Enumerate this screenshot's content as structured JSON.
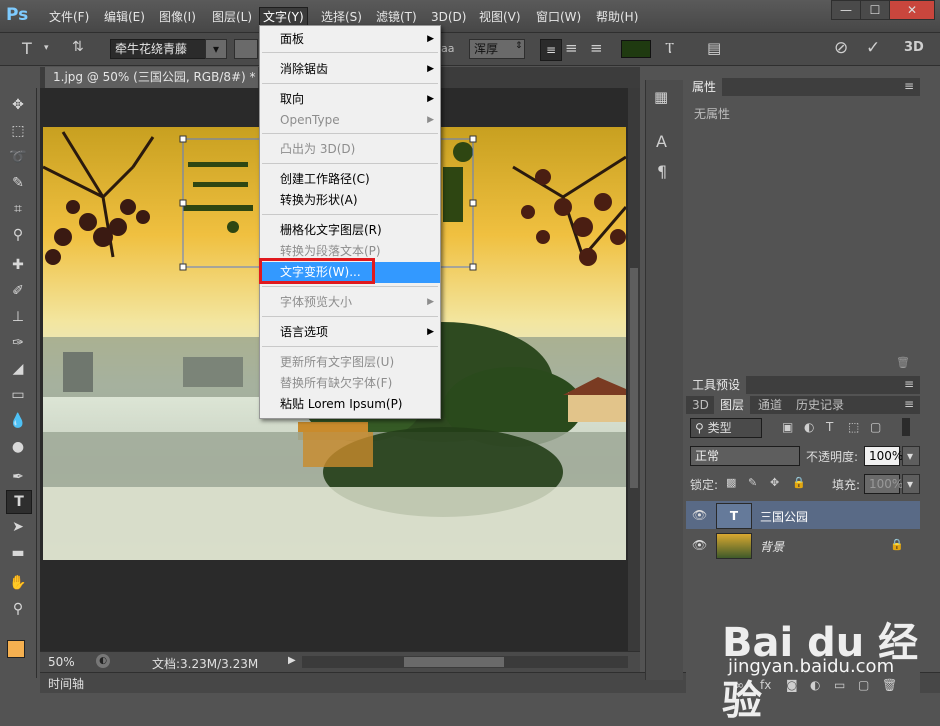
{
  "app": {
    "logo": "Ps"
  },
  "menubar": {
    "items": [
      "文件(F)",
      "编辑(E)",
      "图像(I)",
      "图层(L)",
      "文字(Y)",
      "选择(S)",
      "滤镜(T)",
      "3D(D)",
      "视图(V)",
      "窗口(W)",
      "帮助(H)"
    ],
    "active": "文字(Y)"
  },
  "window_controls": {
    "minimize": "—",
    "maximize": "☐",
    "close": "✕"
  },
  "options_bar": {
    "font_family": "牵牛花绕青藤",
    "font_size_unit": "aa",
    "antialias": "浑厚",
    "color": "#1f3a10",
    "label_3d": "3D"
  },
  "document": {
    "tab_title": "1.jpg @ 50% (三国公园, RGB/8#) *",
    "zoom": "50%",
    "doc_size": "文档:3.23M/3.23M"
  },
  "timeline": {
    "label": "时间轴"
  },
  "menu": {
    "items": [
      {
        "label": "面板",
        "disabled": false,
        "submenu": true
      },
      {
        "label": "消除锯齿",
        "disabled": false,
        "submenu": true
      },
      {
        "label": "取向",
        "disabled": false,
        "submenu": true
      },
      {
        "label": "OpenType",
        "disabled": true,
        "submenu": true
      },
      {
        "label": "凸出为 3D(D)",
        "disabled": true,
        "submenu": false
      },
      {
        "label": "创建工作路径(C)",
        "disabled": false,
        "submenu": false
      },
      {
        "label": "转换为形状(A)",
        "disabled": false,
        "submenu": false
      },
      {
        "label": "栅格化文字图层(R)",
        "disabled": false,
        "submenu": false
      },
      {
        "label": "转换为段落文本(P)",
        "disabled": true,
        "submenu": false
      },
      {
        "label": "文字变形(W)...",
        "disabled": false,
        "submenu": false,
        "highlighted": true
      },
      {
        "label": "字体预览大小",
        "disabled": true,
        "submenu": true
      },
      {
        "label": "语言选项",
        "disabled": false,
        "submenu": true
      },
      {
        "label": "更新所有文字图层(U)",
        "disabled": true,
        "submenu": false
      },
      {
        "label": "替换所有缺欠字体(F)",
        "disabled": true,
        "submenu": false
      },
      {
        "label": "粘贴 Lorem Ipsum(P)",
        "disabled": false,
        "submenu": false
      }
    ]
  },
  "properties_panel": {
    "tab": "属性",
    "content": "无属性"
  },
  "tool_presets_panel": {
    "tab": "工具预设"
  },
  "layers_panel": {
    "tabs": [
      "3D",
      "图层",
      "通道",
      "历史记录"
    ],
    "selected_tab": "图层",
    "filter_label": "类型",
    "blend_mode": "正常",
    "opacity_label": "不透明度:",
    "opacity": "100%",
    "lock_label": "锁定:",
    "fill_label": "填充:",
    "fill": "100%",
    "layers": [
      {
        "name": "三国公园",
        "thumb": "T",
        "selected": true
      },
      {
        "name": "背景",
        "thumb": "",
        "selected": false
      }
    ]
  },
  "colors": {
    "foreground": "#f5b050",
    "background": "#ffffff",
    "highlight": "#3399ff",
    "callout": "#e0191e"
  },
  "watermark": {
    "brand": "Bai du 经验",
    "url": "jingyan.baidu.com"
  }
}
